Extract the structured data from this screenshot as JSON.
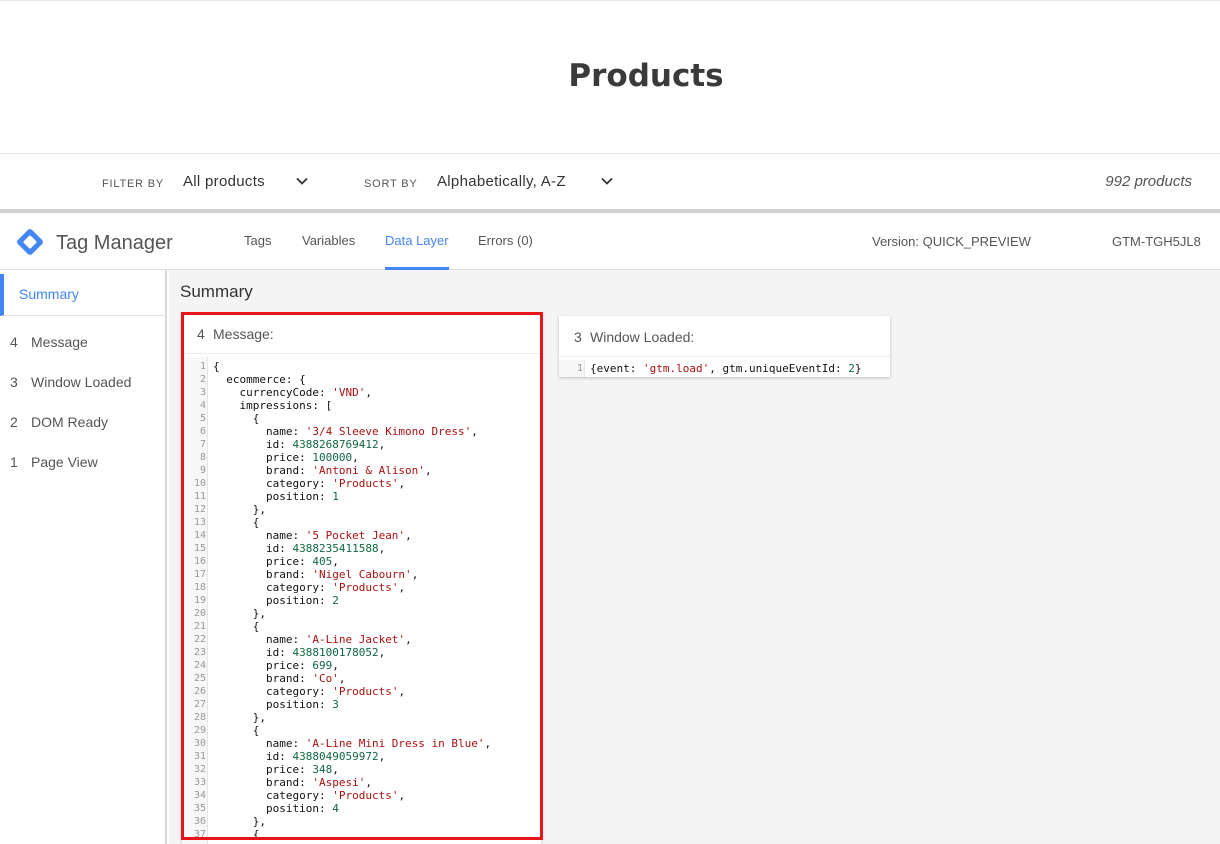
{
  "store": {
    "title": "Products",
    "filter_label": "FILTER BY",
    "filter_value": "All products",
    "sort_label": "SORT BY",
    "sort_value": "Alphabetically, A-Z",
    "product_count": "992 products"
  },
  "gtm": {
    "app_name": "Tag Manager",
    "tabs": [
      "Tags",
      "Variables",
      "Data Layer",
      "Errors (0)"
    ],
    "active_tab": "Data Layer",
    "version": "Version: QUICK_PREVIEW",
    "container_id": "GTM-TGH5JL8",
    "brand_colors": {
      "blue": "#4285f4",
      "dark_blue": "#1a73e8"
    }
  },
  "sidebar": {
    "summary": "Summary",
    "items": [
      {
        "num": "4",
        "label": "Message"
      },
      {
        "num": "3",
        "label": "Window Loaded"
      },
      {
        "num": "2",
        "label": "DOM Ready"
      },
      {
        "num": "1",
        "label": "Page View"
      }
    ]
  },
  "main": {
    "title": "Summary",
    "message_card": {
      "num": "4",
      "label": "Message:",
      "highlight_color": "#e8141c",
      "lines": [
        [
          [
            "p",
            "{"
          ]
        ],
        [
          [
            "p",
            "  ecommerce: {"
          ]
        ],
        [
          [
            "p",
            "    currencyCode: "
          ],
          [
            "s",
            "'VND'"
          ],
          [
            "p",
            ","
          ]
        ],
        [
          [
            "p",
            "    impressions: ["
          ]
        ],
        [
          [
            "p",
            "      {"
          ]
        ],
        [
          [
            "p",
            "        name: "
          ],
          [
            "s",
            "'3/4 Sleeve Kimono Dress'"
          ],
          [
            "p",
            ","
          ]
        ],
        [
          [
            "p",
            "        id: "
          ],
          [
            "n",
            "4388268769412"
          ],
          [
            "p",
            ","
          ]
        ],
        [
          [
            "p",
            "        price: "
          ],
          [
            "n",
            "100000"
          ],
          [
            "p",
            ","
          ]
        ],
        [
          [
            "p",
            "        brand: "
          ],
          [
            "s",
            "'Antoni & Alison'"
          ],
          [
            "p",
            ","
          ]
        ],
        [
          [
            "p",
            "        category: "
          ],
          [
            "s",
            "'Products'"
          ],
          [
            "p",
            ","
          ]
        ],
        [
          [
            "p",
            "        position: "
          ],
          [
            "n",
            "1"
          ]
        ],
        [
          [
            "p",
            "      },"
          ]
        ],
        [
          [
            "p",
            "      {"
          ]
        ],
        [
          [
            "p",
            "        name: "
          ],
          [
            "s",
            "'5 Pocket Jean'"
          ],
          [
            "p",
            ","
          ]
        ],
        [
          [
            "p",
            "        id: "
          ],
          [
            "n",
            "4388235411588"
          ],
          [
            "p",
            ","
          ]
        ],
        [
          [
            "p",
            "        price: "
          ],
          [
            "n",
            "405"
          ],
          [
            "p",
            ","
          ]
        ],
        [
          [
            "p",
            "        brand: "
          ],
          [
            "s",
            "'Nigel Cabourn'"
          ],
          [
            "p",
            ","
          ]
        ],
        [
          [
            "p",
            "        category: "
          ],
          [
            "s",
            "'Products'"
          ],
          [
            "p",
            ","
          ]
        ],
        [
          [
            "p",
            "        position: "
          ],
          [
            "n",
            "2"
          ]
        ],
        [
          [
            "p",
            "      },"
          ]
        ],
        [
          [
            "p",
            "      {"
          ]
        ],
        [
          [
            "p",
            "        name: "
          ],
          [
            "s",
            "'A-Line Jacket'"
          ],
          [
            "p",
            ","
          ]
        ],
        [
          [
            "p",
            "        id: "
          ],
          [
            "n",
            "4388100178052"
          ],
          [
            "p",
            ","
          ]
        ],
        [
          [
            "p",
            "        price: "
          ],
          [
            "n",
            "699"
          ],
          [
            "p",
            ","
          ]
        ],
        [
          [
            "p",
            "        brand: "
          ],
          [
            "s",
            "'Co'"
          ],
          [
            "p",
            ","
          ]
        ],
        [
          [
            "p",
            "        category: "
          ],
          [
            "s",
            "'Products'"
          ],
          [
            "p",
            ","
          ]
        ],
        [
          [
            "p",
            "        position: "
          ],
          [
            "n",
            "3"
          ]
        ],
        [
          [
            "p",
            "      },"
          ]
        ],
        [
          [
            "p",
            "      {"
          ]
        ],
        [
          [
            "p",
            "        name: "
          ],
          [
            "s",
            "'A-Line Mini Dress in Blue'"
          ],
          [
            "p",
            ","
          ]
        ],
        [
          [
            "p",
            "        id: "
          ],
          [
            "n",
            "4388049059972"
          ],
          [
            "p",
            ","
          ]
        ],
        [
          [
            "p",
            "        price: "
          ],
          [
            "n",
            "348"
          ],
          [
            "p",
            ","
          ]
        ],
        [
          [
            "p",
            "        brand: "
          ],
          [
            "s",
            "'Aspesi'"
          ],
          [
            "p",
            ","
          ]
        ],
        [
          [
            "p",
            "        category: "
          ],
          [
            "s",
            "'Products'"
          ],
          [
            "p",
            ","
          ]
        ],
        [
          [
            "p",
            "        position: "
          ],
          [
            "n",
            "4"
          ]
        ],
        [
          [
            "p",
            "      },"
          ]
        ],
        [
          [
            "p",
            "      {"
          ]
        ]
      ]
    },
    "window_card": {
      "num": "3",
      "label": "Window Loaded:",
      "lines": [
        [
          [
            "p",
            "{event: "
          ],
          [
            "s",
            "'gtm.load'"
          ],
          [
            "p",
            ", gtm.uniqueEventId: "
          ],
          [
            "n",
            "2"
          ],
          [
            "p",
            "}"
          ]
        ]
      ]
    }
  }
}
